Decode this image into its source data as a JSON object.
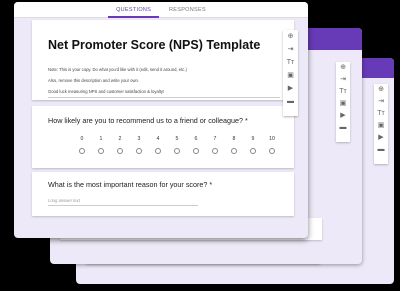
{
  "tabs": [
    {
      "label": "QUESTIONS",
      "active": true
    },
    {
      "label": "RESPONSES",
      "active": false
    }
  ],
  "form": {
    "title": "Net Promoter Score (NPS) Template",
    "description": [
      "Note: This is your copy. Do what you'd like with it (edit, send it around, etc.)",
      "Also, remove this description and write your own.",
      "Good luck measuring NPS and customer satisfaction & loyalty!"
    ]
  },
  "questions": [
    {
      "text": "How likely are you to recommend us to a friend or colleague? *",
      "scale": [
        "0",
        "1",
        "2",
        "3",
        "4",
        "5",
        "6",
        "7",
        "8",
        "9",
        "10"
      ]
    },
    {
      "text": "What is the most important reason for your score? *",
      "placeholder": "Long answer text"
    }
  ],
  "toolbar_icons": [
    "add-icon",
    "import-icon",
    "title-icon",
    "image-icon",
    "video-icon",
    "section-icon"
  ],
  "colors": {
    "accent": "#673ab7",
    "background": "#ede9f8"
  }
}
